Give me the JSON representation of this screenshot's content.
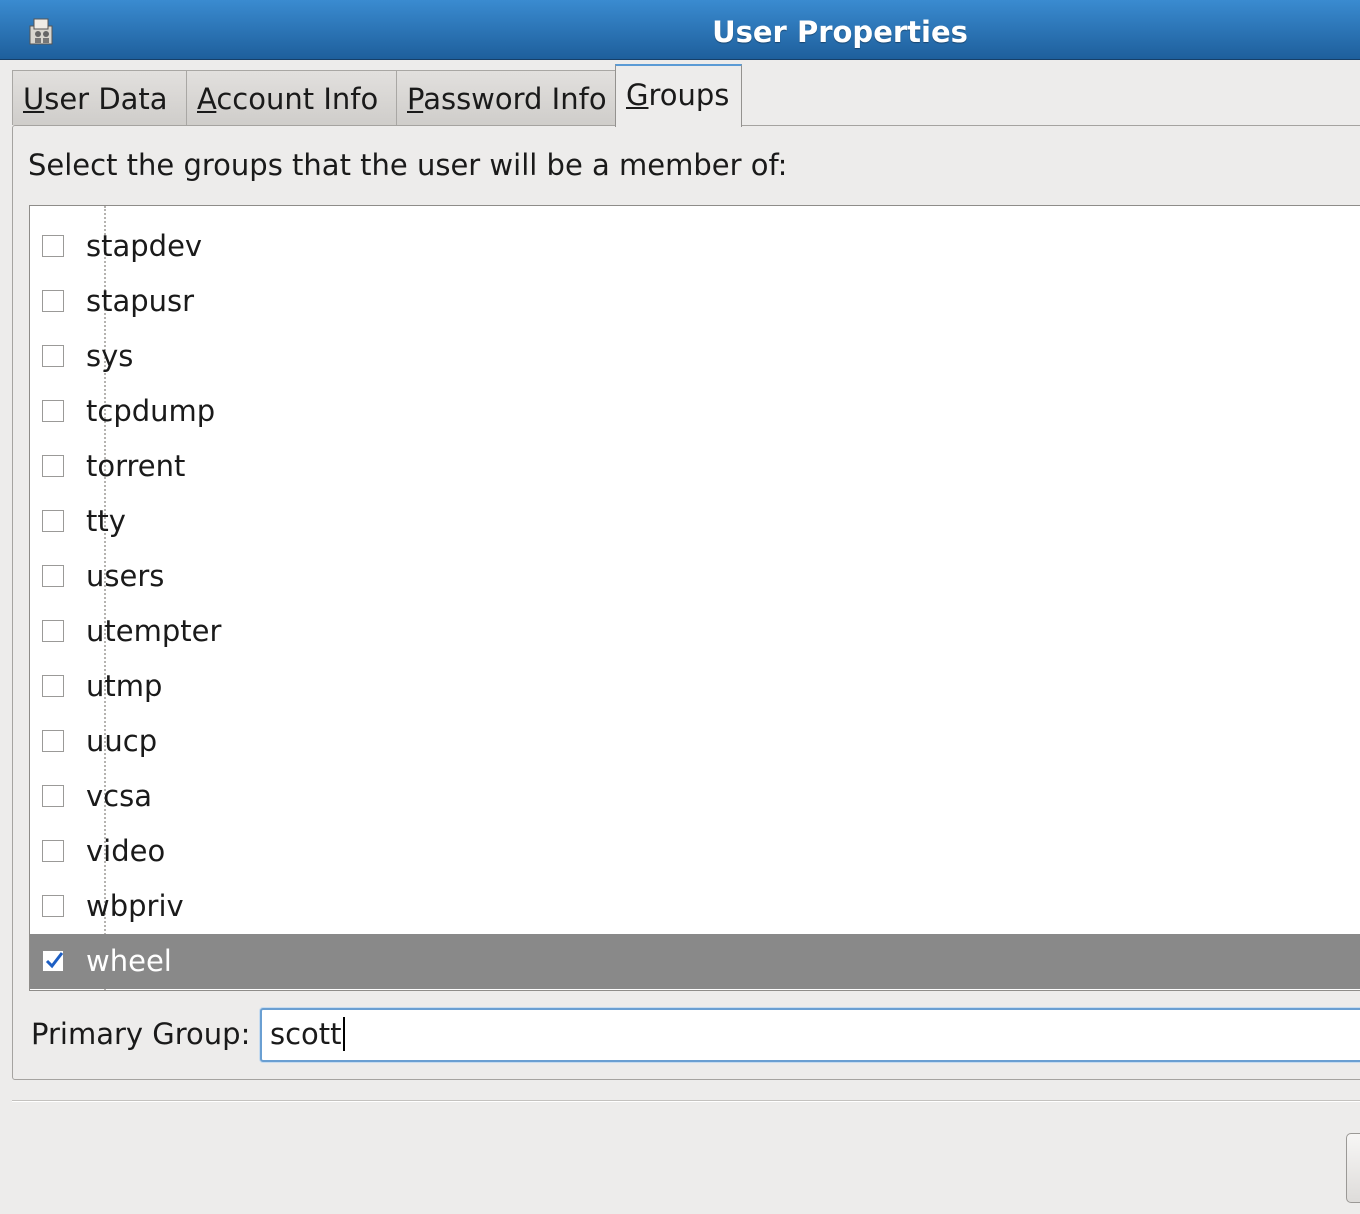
{
  "window": {
    "title": "User Properties",
    "icon": "users-app-icon"
  },
  "tabs": [
    {
      "label": "User Data",
      "mnemonic": "U",
      "rest": "ser Data",
      "active": false
    },
    {
      "label": "Account Info",
      "mnemonic": "A",
      "rest": "ccount Info",
      "active": false
    },
    {
      "label": "Password Info",
      "mnemonic": "P",
      "rest": "assword Info",
      "active": false
    },
    {
      "label": "Groups",
      "mnemonic": "G",
      "rest": "roups",
      "active": true
    }
  ],
  "groups_panel": {
    "instruction": "Select the groups that the user will be a member of:",
    "groups": [
      {
        "name": "stapdev",
        "checked": false
      },
      {
        "name": "stapusr",
        "checked": false
      },
      {
        "name": "sys",
        "checked": false
      },
      {
        "name": "tcpdump",
        "checked": false
      },
      {
        "name": "torrent",
        "checked": false
      },
      {
        "name": "tty",
        "checked": false
      },
      {
        "name": "users",
        "checked": false
      },
      {
        "name": "utempter",
        "checked": false
      },
      {
        "name": "utmp",
        "checked": false
      },
      {
        "name": "uucp",
        "checked": false
      },
      {
        "name": "vcsa",
        "checked": false
      },
      {
        "name": "video",
        "checked": false
      },
      {
        "name": "wbpriv",
        "checked": false
      },
      {
        "name": "wheel",
        "checked": true,
        "selected": true
      }
    ],
    "primary_group_label": "Primary Group:",
    "primary_group_value": "scott"
  },
  "colors": {
    "titlebar": "#2a72b5",
    "selection": "#898989",
    "check": "#1d5fc4"
  }
}
